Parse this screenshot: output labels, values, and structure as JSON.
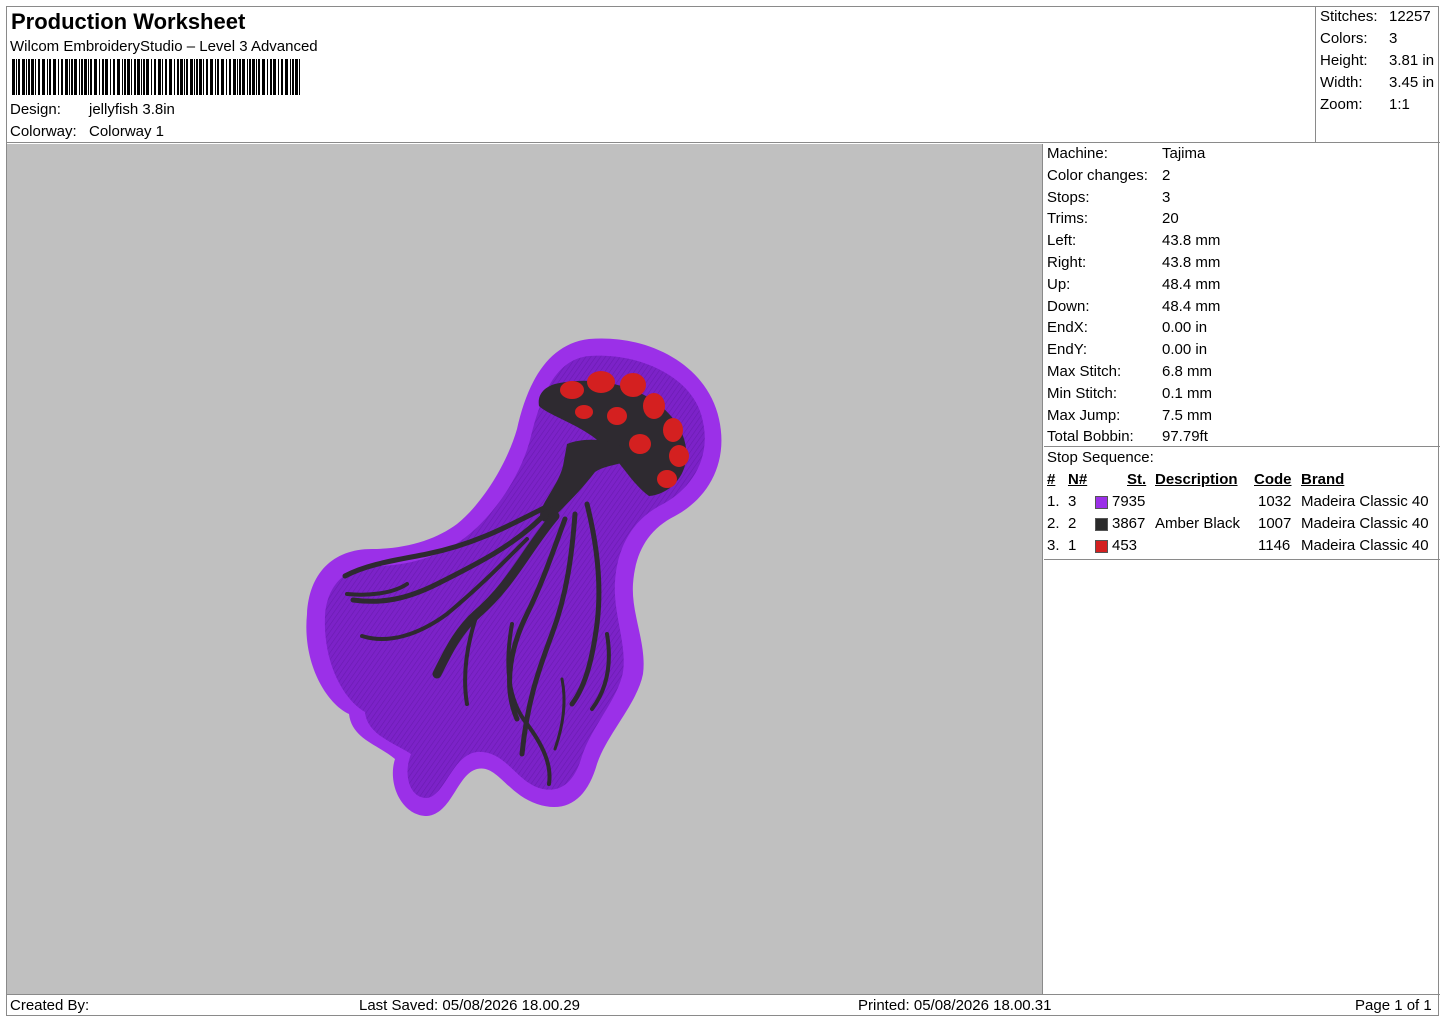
{
  "header": {
    "title": "Production Worksheet",
    "subtitle": "Wilcom EmbroideryStudio – Level 3 Advanced",
    "design_label": "Design:",
    "design_value": "jellyfish 3.8in",
    "colorway_label": "Colorway:",
    "colorway_value": "Colorway 1"
  },
  "summary": [
    {
      "label": "Stitches:",
      "value": "12257"
    },
    {
      "label": "Colors:",
      "value": "3"
    },
    {
      "label": "Height:",
      "value": "3.81 in"
    },
    {
      "label": "Width:",
      "value": "3.45 in"
    },
    {
      "label": "Zoom:",
      "value": "1:1"
    }
  ],
  "machine_info": [
    {
      "label": "Machine:",
      "value": "Tajima"
    },
    {
      "label": "Color changes:",
      "value": "2"
    },
    {
      "label": "Stops:",
      "value": "3"
    },
    {
      "label": "Trims:",
      "value": "20"
    },
    {
      "label": "Left:",
      "value": "43.8 mm"
    },
    {
      "label": "Right:",
      "value": "43.8 mm"
    },
    {
      "label": "Up:",
      "value": "48.4 mm"
    },
    {
      "label": "Down:",
      "value": "48.4 mm"
    },
    {
      "label": "EndX:",
      "value": "0.00 in"
    },
    {
      "label": "EndY:",
      "value": "0.00 in"
    },
    {
      "label": "Max Stitch:",
      "value": "6.8 mm"
    },
    {
      "label": "Min Stitch:",
      "value": "0.1 mm"
    },
    {
      "label": "Max Jump:",
      "value": "7.5 mm"
    },
    {
      "label": "Total Bobbin:",
      "value": "97.79ft"
    }
  ],
  "stop_sequence": {
    "title": "Stop Sequence:",
    "headers": {
      "num": "#",
      "n": "N#",
      "st": "St.",
      "description": "Description",
      "code": "Code",
      "brand": "Brand"
    },
    "rows": [
      {
        "num": "1.",
        "n": "3",
        "color": "#9b30e8",
        "st": "7935",
        "description": "",
        "code": "1032",
        "brand": "Madeira Classic 40"
      },
      {
        "num": "2.",
        "n": "2",
        "color": "#2a2a2a",
        "st": "3867",
        "description": "Amber Black",
        "code": "1007",
        "brand": "Madeira Classic 40"
      },
      {
        "num": "3.",
        "n": "1",
        "color": "#d42020",
        "st": "453",
        "description": "",
        "code": "1146",
        "brand": "Madeira Classic 40"
      }
    ]
  },
  "footer": {
    "created_by": "Created By:",
    "last_saved": "Last Saved: 05/08/2026 18.00.29",
    "printed": "Printed: 05/08/2026 18.00.31",
    "page": "Page 1 of 1"
  },
  "colors": {
    "canvas_bg": "#c0c0c0",
    "patch_border": "#9b30e8",
    "patch_fill": "#7c22c8",
    "tentacle": "#2e2a30",
    "spots": "#d42020"
  }
}
